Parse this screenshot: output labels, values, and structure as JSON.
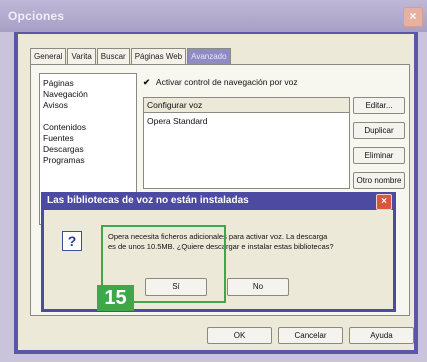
{
  "window": {
    "title": "Opciones",
    "close_symbol": "×"
  },
  "tabs": [
    {
      "label": "General",
      "active": false
    },
    {
      "label": "Varita",
      "active": false
    },
    {
      "label": "Buscar",
      "active": false
    },
    {
      "label": "Páginas Web",
      "active": false
    },
    {
      "label": "Avanzado",
      "active": true
    }
  ],
  "categories": [
    "Páginas",
    "Navegación",
    "Avisos",
    "Contenidos",
    "Fuentes",
    "Descargas",
    "Programas"
  ],
  "voice": {
    "checkbox_label": "Activar control de navegación por voz",
    "checked": true,
    "check_symbol": "✔",
    "list_header": "Configurar voz",
    "list_items": [
      "Opera Standard"
    ],
    "buttons": {
      "edit": "Editar...",
      "duplicate": "Duplicar",
      "delete": "Eliminar",
      "other_name": "Otro nombre"
    }
  },
  "dialog": {
    "title": "Las bibliotecas de voz no están instaladas",
    "close_symbol": "×",
    "icon_symbol": "?",
    "message_line1": "Opera necesita ficheros adicionales para activar voz. La descarga",
    "message_line2": "es de unos 10.5MB. ¿Quiere descargar e instalar estas bibliotecas?",
    "yes": "Sí",
    "no": "No",
    "step_badge": "15"
  },
  "footer": {
    "ok": "OK",
    "cancel": "Cancelar",
    "help": "Ayuda"
  },
  "colors": {
    "frame": "#5a57a6",
    "dialog_frame": "#4d4aa1",
    "highlight": "#3fa74b",
    "dialog_close": "#d9573b"
  },
  "icons": {
    "close": "close-icon",
    "question": "question-icon",
    "check": "checkmark-icon"
  }
}
